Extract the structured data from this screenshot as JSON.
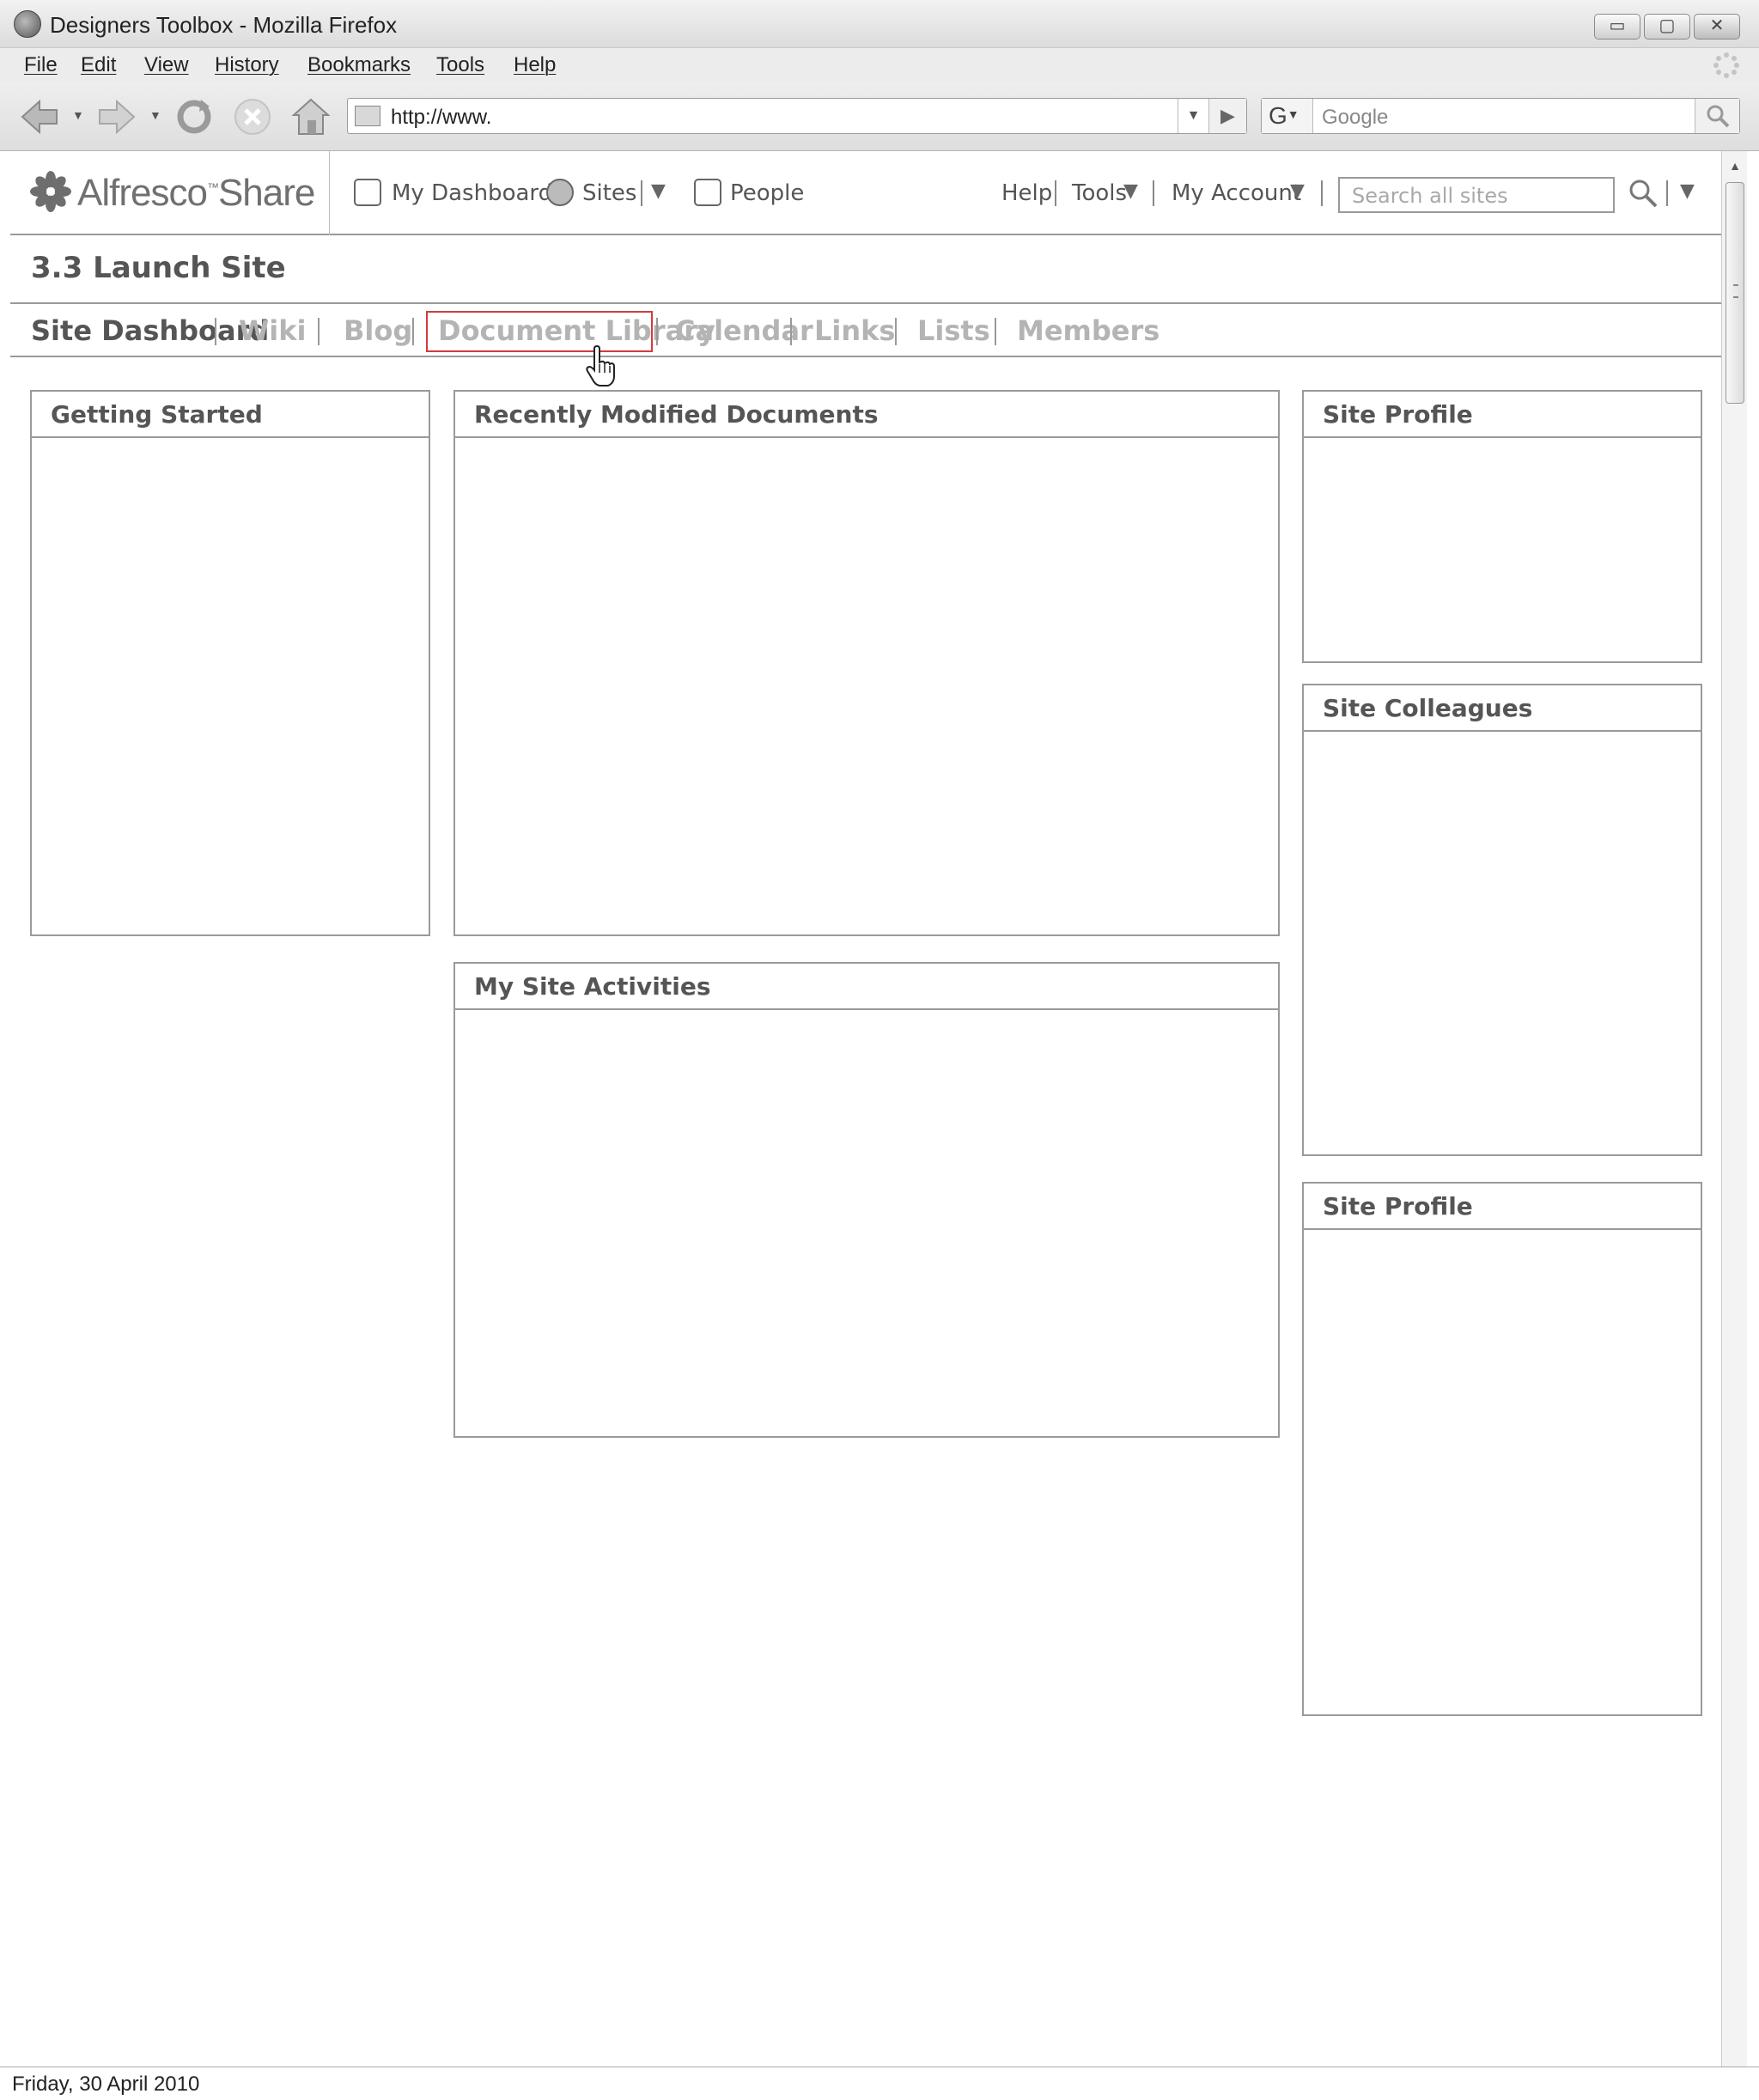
{
  "window": {
    "title": "Designers Toolbox - Mozilla Firefox",
    "controls": {
      "minimize": "▭",
      "maximize": "▢",
      "close": "✕"
    }
  },
  "menubar": {
    "items": [
      "File",
      "Edit",
      "View",
      "History",
      "Bookmarks",
      "Tools",
      "Help"
    ]
  },
  "navbar": {
    "url": "http://www.",
    "search_engine": "G",
    "search_placeholder": "Google",
    "icons": [
      "back-icon",
      "forward-icon",
      "reload-icon",
      "stop-icon",
      "home-icon",
      "go-icon",
      "search-icon"
    ]
  },
  "share_header": {
    "logo_text": "Alfresco",
    "logo_tm": "™",
    "logo_product": "Share",
    "nav": [
      "My Dashboard",
      "Sites",
      "People"
    ],
    "links": [
      "Help",
      "Tools",
      "My Account"
    ],
    "search_placeholder": "Search all sites"
  },
  "site": {
    "title": "3.3 Launch Site",
    "nav": [
      "Site Dashboard",
      "Wiki",
      "Blog",
      "Document Library",
      "Calendar",
      "Links",
      "Lists",
      "Members"
    ],
    "active_item": "Site Dashboard",
    "highlighted_item": "Document Library"
  },
  "dashlets": {
    "getting_started": "Getting Started",
    "recently_modified": "Recently Modified Documents",
    "my_site_activities": "My Site Activities",
    "site_profile_1": "Site Profile",
    "site_colleagues": "Site Colleagues",
    "site_profile_2": "Site Profile"
  },
  "footer": {
    "date": "Friday, 30 April 2010"
  },
  "colors": {
    "highlight": "#d23c3c",
    "inactive_nav": "#b4b4b4",
    "active_nav": "#555555"
  }
}
